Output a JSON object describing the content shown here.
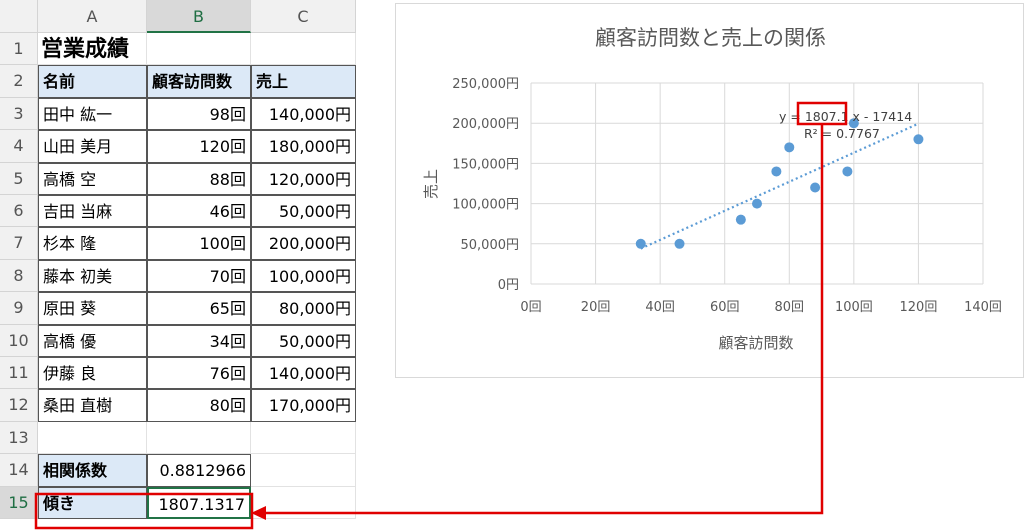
{
  "sheet": {
    "columns": [
      "A",
      "B",
      "C"
    ],
    "rows": [
      "1",
      "2",
      "3",
      "4",
      "5",
      "6",
      "7",
      "8",
      "9",
      "10",
      "11",
      "12",
      "13",
      "14",
      "15"
    ],
    "title": "営業成績",
    "headers": {
      "name": "名前",
      "visits": "顧客訪問数",
      "sales": "売上"
    },
    "data": [
      {
        "name": "田中 紘一",
        "visits": "98回",
        "sales": "140,000円"
      },
      {
        "name": "山田 美月",
        "visits": "120回",
        "sales": "180,000円"
      },
      {
        "name": "高橋 空",
        "visits": "88回",
        "sales": "120,000円"
      },
      {
        "name": "吉田 当麻",
        "visits": "46回",
        "sales": "50,000円"
      },
      {
        "name": "杉本 隆",
        "visits": "100回",
        "sales": "200,000円"
      },
      {
        "name": "藤本 初美",
        "visits": "70回",
        "sales": "100,000円"
      },
      {
        "name": "原田 葵",
        "visits": "65回",
        "sales": "80,000円"
      },
      {
        "name": "高橋 優",
        "visits": "34回",
        "sales": "50,000円"
      },
      {
        "name": "伊藤 良",
        "visits": "76回",
        "sales": "140,000円"
      },
      {
        "name": "桑田 直樹",
        "visits": "80回",
        "sales": "170,000円"
      }
    ],
    "correl_label": "相関係数",
    "correl_value": "0.8812966",
    "slope_label": "傾き",
    "slope_value": "1807.1317"
  },
  "chart_data": {
    "type": "scatter",
    "title": "顧客訪問数と売上の関係",
    "xlabel": "顧客訪問数",
    "ylabel": "売上",
    "xlim": [
      0,
      140
    ],
    "ylim": [
      0,
      250000
    ],
    "x_ticks": [
      "0回",
      "20回",
      "40回",
      "60回",
      "80回",
      "100回",
      "120回",
      "140回"
    ],
    "y_ticks": [
      "0円",
      "50,000円",
      "100,000円",
      "150,000円",
      "200,000円",
      "250,000円"
    ],
    "points": [
      {
        "x": 98,
        "y": 140000
      },
      {
        "x": 120,
        "y": 180000
      },
      {
        "x": 88,
        "y": 120000
      },
      {
        "x": 46,
        "y": 50000
      },
      {
        "x": 100,
        "y": 200000
      },
      {
        "x": 70,
        "y": 100000
      },
      {
        "x": 65,
        "y": 80000
      },
      {
        "x": 34,
        "y": 50000
      },
      {
        "x": 76,
        "y": 140000
      },
      {
        "x": 80,
        "y": 170000
      }
    ],
    "trendline": {
      "slope": 1807.1317,
      "intercept": -17414
    },
    "equation_prefix": "y = ",
    "equation_slope": "1807.1",
    "equation_suffix": "x - 17414",
    "r2_text": "R² = 0.7767",
    "grid": true,
    "colors": {
      "point": "#5b9bd5",
      "trend": "#5b9bd5",
      "highlight": "#e00000"
    }
  }
}
